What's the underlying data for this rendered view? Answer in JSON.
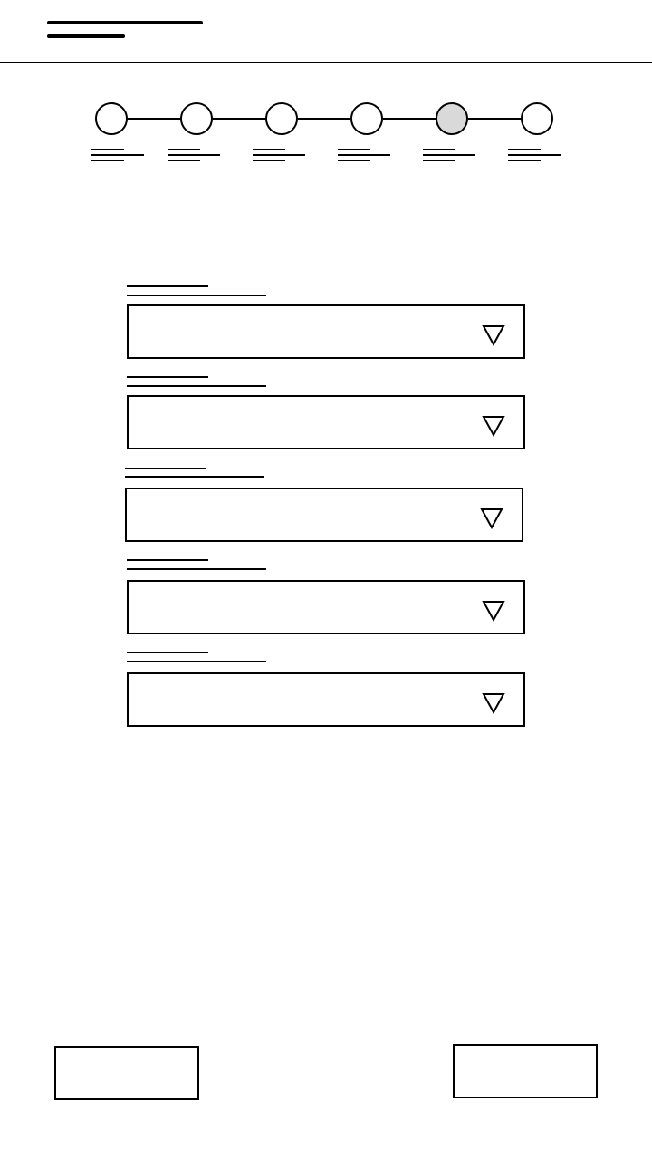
{
  "stepper": {
    "current_step": 5,
    "total_steps": 6,
    "active_fill": "#d9d9d9"
  },
  "form": {
    "field_count": 5
  },
  "colors": {
    "line": "#000000",
    "background": "#ffffff"
  }
}
